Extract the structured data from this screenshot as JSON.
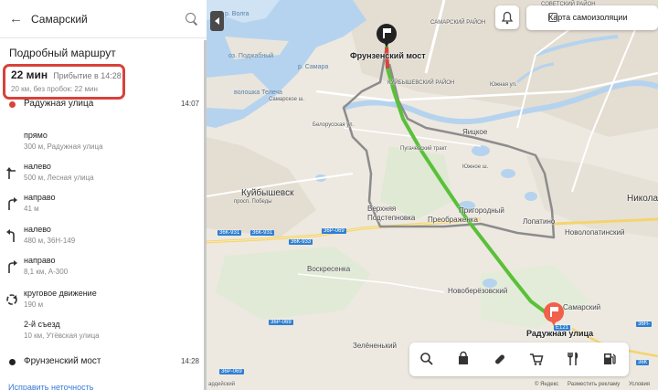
{
  "search": {
    "value": "Самарский"
  },
  "panel": {
    "title": "Подробный маршрут",
    "summary": {
      "duration": "22 мин",
      "arrival": "Прибытие в 14:28",
      "details": "20 км, без пробок: 22 мин"
    },
    "start": {
      "name": "Радужная улица",
      "time": "14:07"
    },
    "steps": [
      {
        "icon": "straight-arrow-icon",
        "action": "прямо",
        "detail": "300 м, Радужная улица"
      },
      {
        "icon": "turn-left-icon",
        "action": "налево",
        "detail": "500 м, Лесная улица"
      },
      {
        "icon": "turn-right-icon",
        "action": "направо",
        "detail": "41 м"
      },
      {
        "icon": "turn-left-icon",
        "action": "налево",
        "detail": "480 м, 36Н-149"
      },
      {
        "icon": "turn-right-icon",
        "action": "направо",
        "detail": "8,1 км, А-300"
      },
      {
        "icon": "roundabout-icon",
        "action": "круговое движение",
        "detail": "190 м"
      },
      {
        "icon": "straight-arrow-icon",
        "action": "2-й съезд",
        "detail": "10 км, Утёвская улица"
      }
    ],
    "finish": {
      "name": "Фрунзенский мост",
      "time": "14:28"
    },
    "fix_link": "Исправить неточность"
  },
  "map": {
    "isolation_button": "Карта самоизоляции",
    "start_label": "Фрунзенский мост",
    "end_label": "Радужная улица",
    "labels": {
      "samarsky_rayon": "САМАРСКИЙ РАЙОН",
      "sovetsky": "СОВЕТСКИЙ РАЙОН",
      "kuybyshevsky": "КУЙБЫШЕВСКИЙ РАЙОН",
      "kuybyshevsk": "Куйбышевск",
      "pugachevsky": "Пугачёвский тракт",
      "prospekt_pobedy": "просп. Победы",
      "samarskoe_sh": "Самарское ш.",
      "belorusskaya": "Белорусская ул.",
      "yuzhnoe_sh": "Южное ш.",
      "yugorskaya": "Южная ул.",
      "yaitskoe": "Яицкое",
      "verkhnyaya": "Верхняя",
      "podstepnovka": "Подстепновка",
      "prigorodny": "Пригородный",
      "preobrazhenka": "Преображенка",
      "lopatino": "Лопатино",
      "novopotatinskiy": "Новолопатинский",
      "nikolaevka": "Николаев",
      "voskresenka": "Воскресенка",
      "novoberezovsky": "Новоберёзовский",
      "zelenenky": "Зелёненький",
      "samarskiy": "Самарский",
      "ardeyskiy": "ардейский",
      "river_volga": "р. Волга",
      "ozero_podzhabny": "оз. Поджабный",
      "volga_ozero": "волошка Телеча",
      "r_samara": "р. Самара"
    },
    "shields": [
      "36К-931",
      "36К-931",
      "36К-933",
      "36Р-069",
      "36Р-069",
      "36Р-069",
      "36Н-",
      "36К",
      "Е121"
    ],
    "toolbar_icons": [
      "search-icon",
      "shopping-bag-icon",
      "pharmacy-icon",
      "cart-icon",
      "restaurant-icon",
      "gas-station-icon"
    ],
    "footer": {
      "brand": "© Яндекс",
      "ads": "Разместить рекламу",
      "terms": "Условия"
    },
    "route_color": "#5ac03a",
    "alt_route_color": "#8c8c8c",
    "water_color": "#b5d3ee",
    "land_color": "#e9e5dc"
  }
}
